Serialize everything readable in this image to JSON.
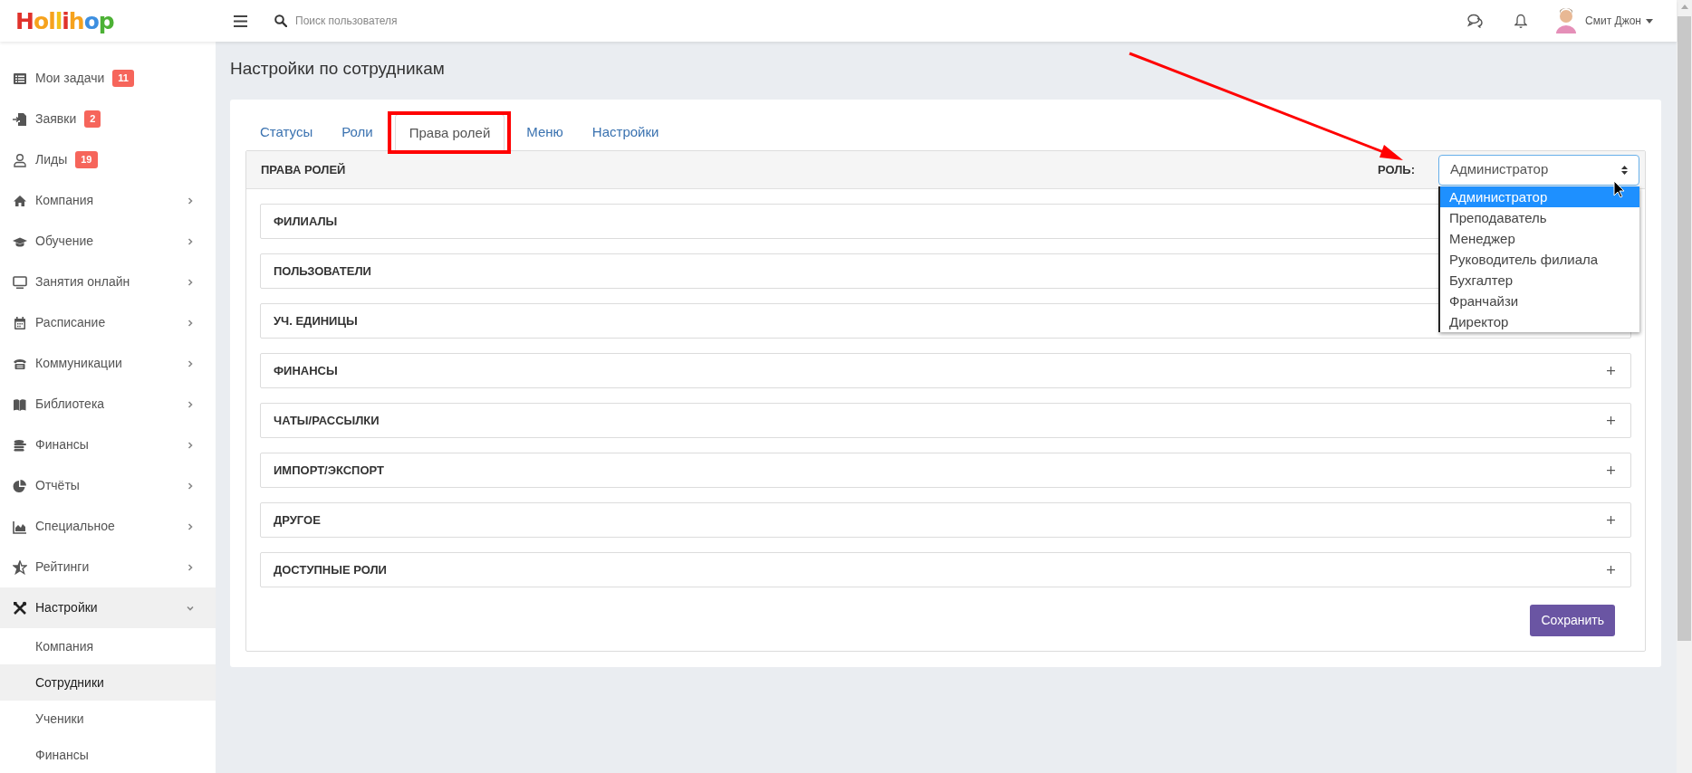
{
  "header": {
    "logo": "Hollihop",
    "search": {
      "placeholder": "Поиск пользователя"
    },
    "user": {
      "name": "Смит Джон"
    }
  },
  "sidebar": {
    "items": [
      {
        "label": "Мои задачи",
        "kind": "link",
        "badge": "11",
        "selected": false
      },
      {
        "label": "Заявки",
        "kind": "link",
        "badge": "2",
        "selected": false
      },
      {
        "label": "Лиды",
        "kind": "link",
        "badge": "19",
        "selected": false
      },
      {
        "label": "Компания",
        "kind": "group",
        "expanded": false,
        "selected": false
      },
      {
        "label": "Обучение",
        "kind": "group",
        "expanded": false,
        "selected": false
      },
      {
        "label": "Занятия онлайн",
        "kind": "group",
        "expanded": false,
        "selected": false
      },
      {
        "label": "Расписание",
        "kind": "group",
        "expanded": false,
        "selected": false
      },
      {
        "label": "Коммуникации",
        "kind": "group",
        "expanded": false,
        "selected": false
      },
      {
        "label": "Библиотека",
        "kind": "group",
        "expanded": false,
        "selected": false
      },
      {
        "label": "Финансы",
        "kind": "group",
        "expanded": false,
        "selected": false
      },
      {
        "label": "Отчёты",
        "kind": "group",
        "expanded": false,
        "selected": false
      },
      {
        "label": "Специальное",
        "kind": "group",
        "expanded": false,
        "selected": false
      },
      {
        "label": "Рейтинги",
        "kind": "group",
        "expanded": false,
        "selected": false
      },
      {
        "label": "Настройки",
        "kind": "group",
        "expanded": true,
        "selected": true,
        "children": [
          {
            "label": "Компания",
            "selected": false
          },
          {
            "label": "Сотрудники",
            "selected": true
          },
          {
            "label": "Ученики",
            "selected": false
          },
          {
            "label": "Финансы",
            "selected": false
          }
        ]
      }
    ]
  },
  "page": {
    "title": "Настройки по сотрудникам",
    "tabs": [
      {
        "label": "Статусы",
        "selected": false
      },
      {
        "label": "Роли",
        "selected": false
      },
      {
        "label": "Права ролей",
        "selected": true
      },
      {
        "label": "Меню",
        "selected": false
      },
      {
        "label": "Настройки",
        "selected": false
      }
    ],
    "panel": {
      "title": "ПРАВА РОЛЕЙ",
      "role_label": "РОЛЬ:",
      "role_select": {
        "value": "Администратор",
        "open": true,
        "options": [
          {
            "label": "Администратор",
            "selected": true
          },
          {
            "label": "Преподаватель",
            "selected": false
          },
          {
            "label": "Менеджер",
            "selected": false
          },
          {
            "label": "Руководитель филиала",
            "selected": false
          },
          {
            "label": "Бухгалтер",
            "selected": false
          },
          {
            "label": "Франчайзи",
            "selected": false
          },
          {
            "label": "Директор",
            "selected": false
          }
        ]
      },
      "sections": [
        {
          "title": "ФИЛИАЛЫ",
          "expanded": false
        },
        {
          "title": "ПОЛЬЗОВАТЕЛИ",
          "expanded": false
        },
        {
          "title": "УЧ. ЕДИНИЦЫ",
          "expanded": false
        },
        {
          "title": "ФИНАНСЫ",
          "expanded": false
        },
        {
          "title": "ЧАТЫ/РАССЫЛКИ",
          "expanded": false
        },
        {
          "title": "ИМПОРТ/ЭКСПОРТ",
          "expanded": false
        },
        {
          "title": "ДРУГОЕ",
          "expanded": false
        },
        {
          "title": "ДОСТУПНЫЕ РОЛИ",
          "expanded": false
        }
      ],
      "save_button": "Сохранить"
    }
  },
  "annotations": {
    "tab_highlight": true,
    "arrow_to_role": true
  }
}
